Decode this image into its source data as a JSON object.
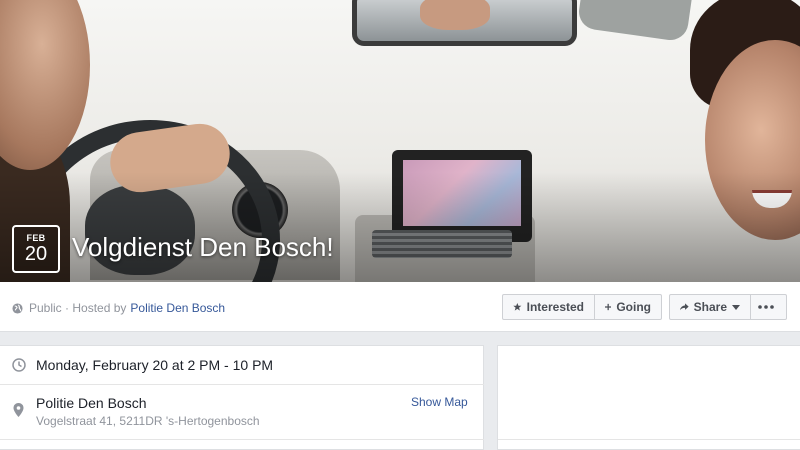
{
  "event": {
    "date_month": "FEB",
    "date_day": "20",
    "title": "Volgdienst Den Bosch!"
  },
  "host_line": {
    "privacy": "Public · Hosted by",
    "host_name": "Politie Den Bosch"
  },
  "actions": {
    "interested_label": "Interested",
    "going_label": "Going",
    "share_label": "Share"
  },
  "details": {
    "time": "Monday, February 20 at 2 PM - 10 PM",
    "place_name": "Politie Den Bosch",
    "place_address": "Vogelstraat 41, 5211DR 's-Hertogenbosch",
    "show_map_label": "Show Map"
  },
  "colors": {
    "link": "#365899",
    "page_bg": "#e9ebee",
    "muted_text": "#90949c"
  },
  "icons": [
    "globe-icon",
    "star-icon",
    "plus-icon",
    "share-arrow-icon",
    "chevron-down-icon",
    "more-icon",
    "clock-icon",
    "location-pin-icon"
  ]
}
